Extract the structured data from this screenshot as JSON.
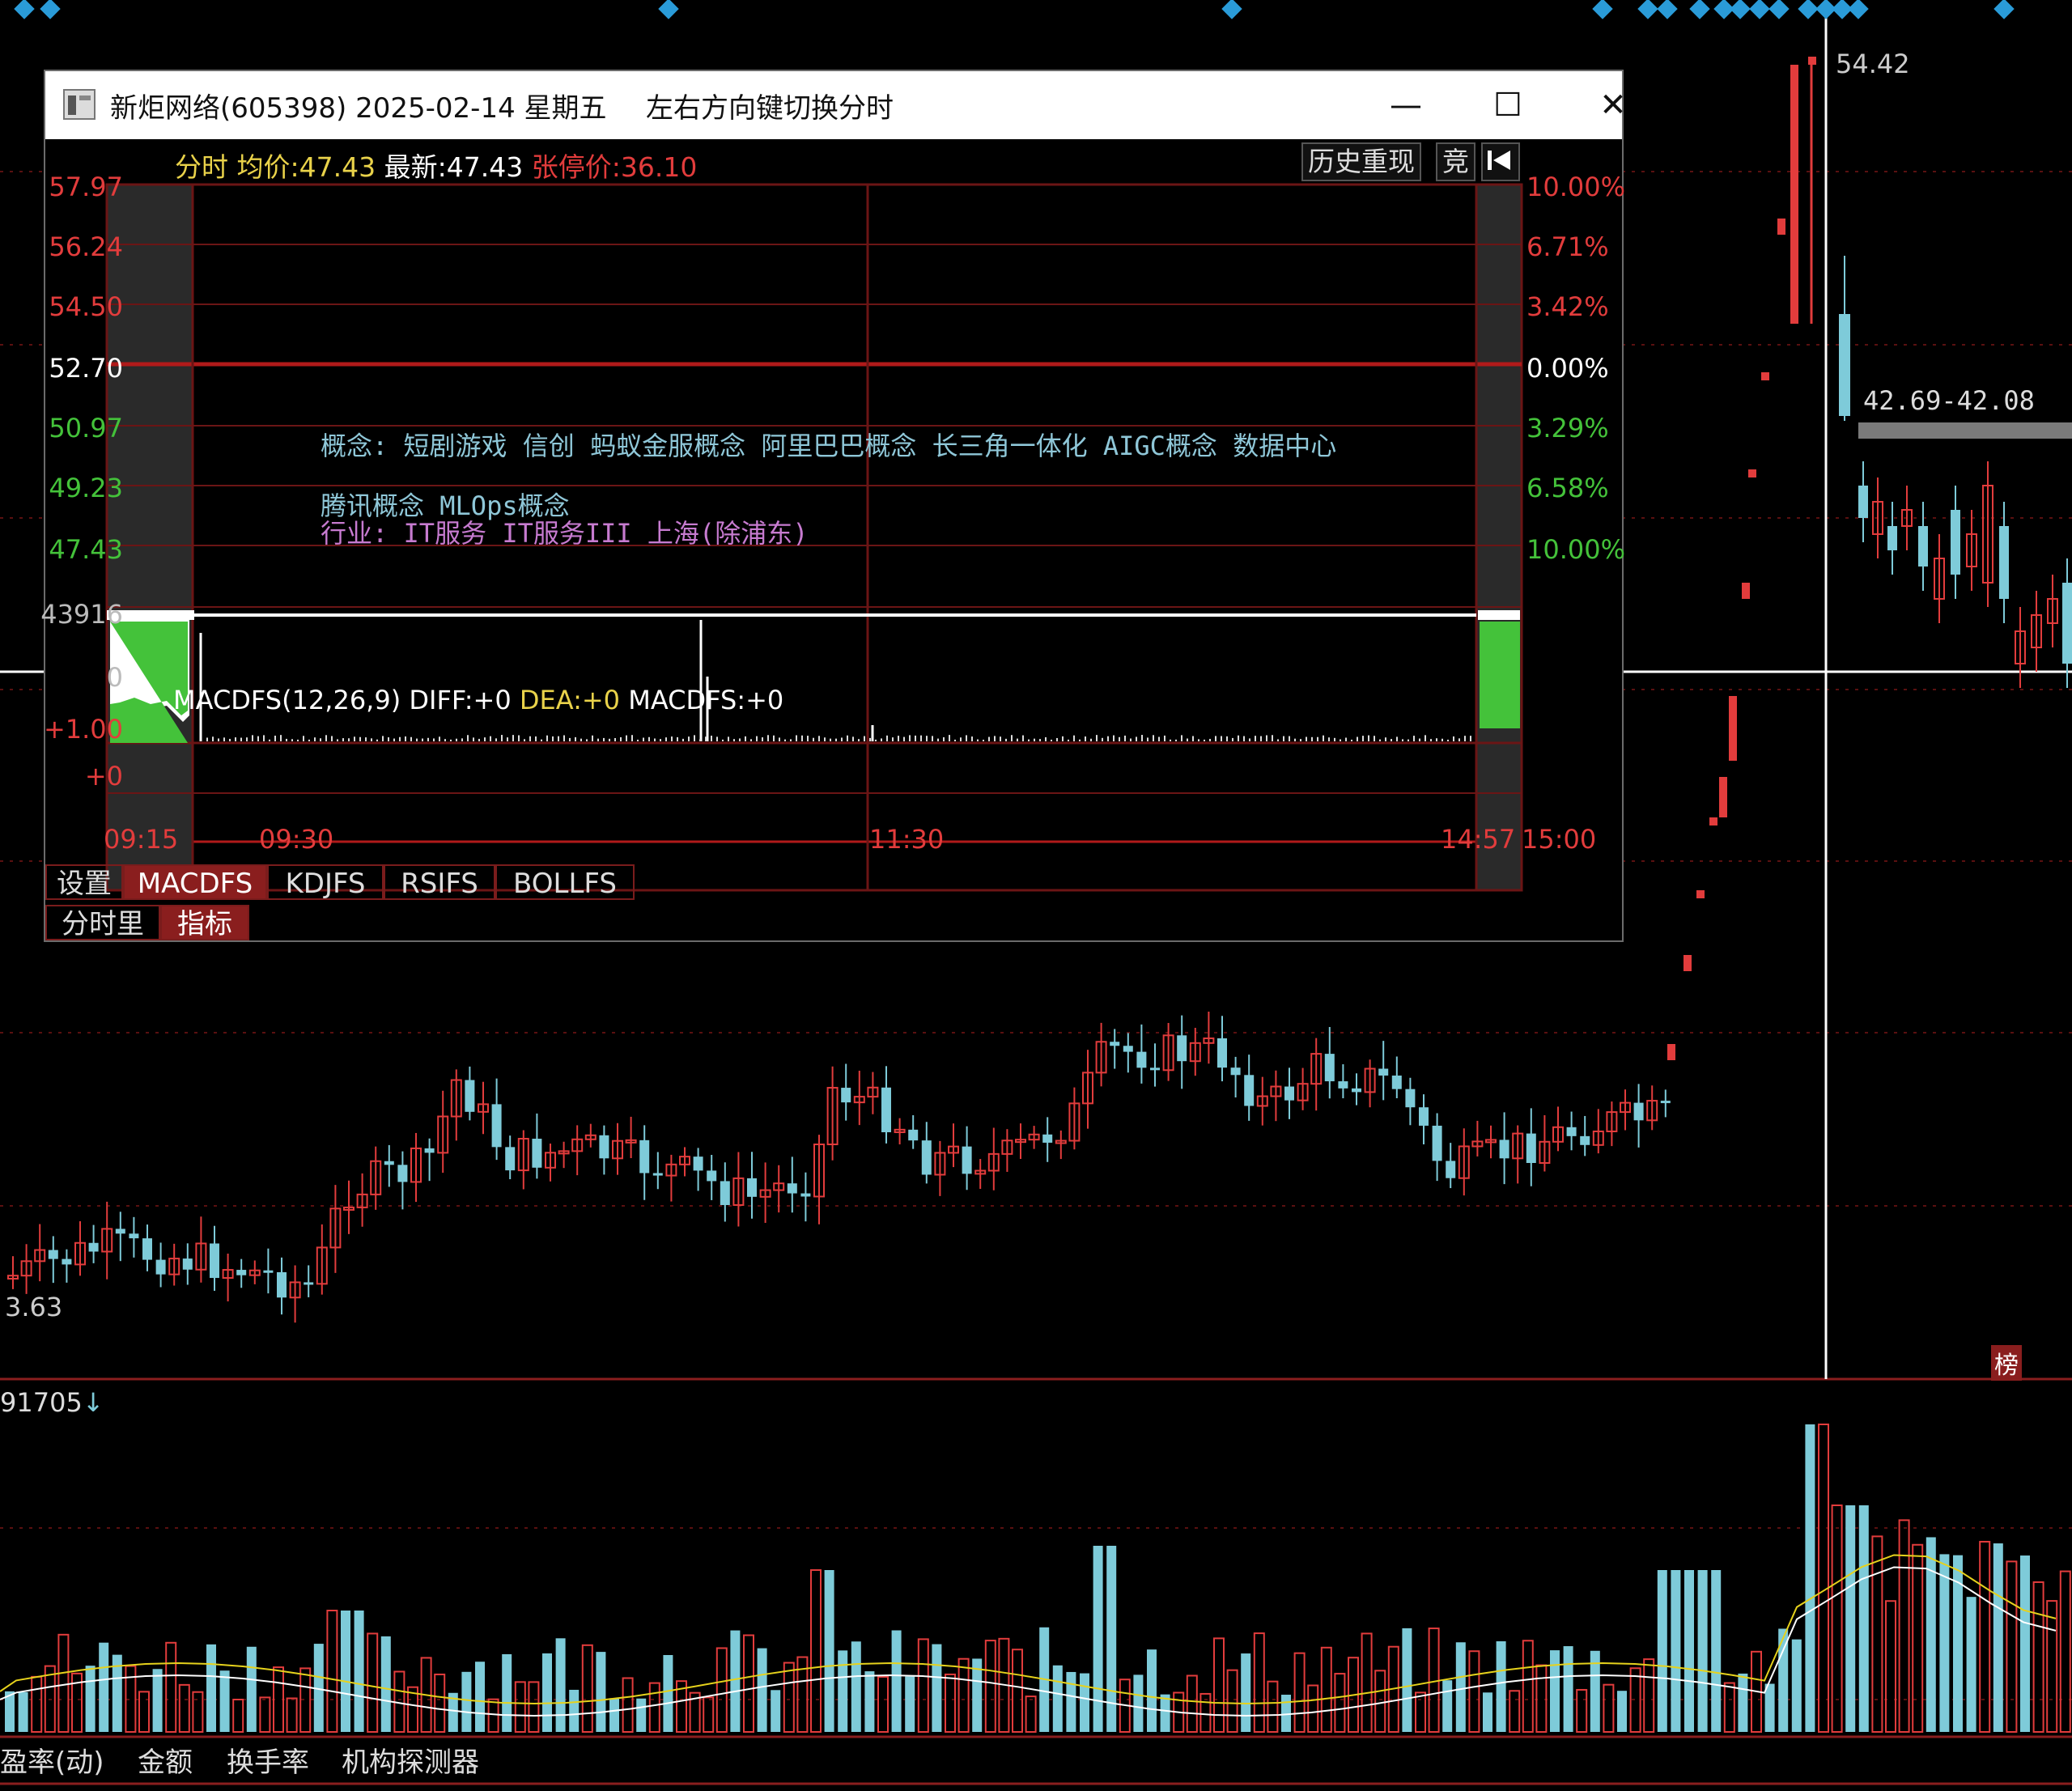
{
  "main_chart": {
    "price_right_label": "54.42",
    "range_label": "42.69-42.08",
    "low_label": "3.63",
    "list_badge": "榜",
    "volume_value": "91705"
  },
  "bottom_tabs": [
    "盈率(动)",
    "金额",
    "换手率",
    "机构探测器"
  ],
  "popup": {
    "title": "新炬网络(605398) 2025-02-14 星期五",
    "hint": "左右方向键切换分时",
    "minimize": "—",
    "maximize": "☐",
    "close": "✕",
    "info": {
      "prefix": "分时",
      "avg_label": "均价:",
      "avg": "47.43",
      "last_label": "最新:",
      "last": "47.43",
      "limit_label": "张停价:",
      "limit": "36.10"
    },
    "history_btn": "历史重现",
    "auction_btn": "竞",
    "back_icon": "back-to-start-icon",
    "price_axis_left": [
      "57.97",
      "56.24",
      "54.50",
      "52.70",
      "50.97",
      "49.23",
      "47.43"
    ],
    "pct_axis_right": [
      "10.00%",
      "6.71%",
      "3.42%",
      "0.00%",
      "3.29%",
      "6.58%",
      "10.00%"
    ],
    "volume_axis": [
      "43916",
      "0"
    ],
    "concept_line1": "概念: 短剧游戏 信创 蚂蚁金服概念 阿里巴巴概念 长三角一体化 AIGC概念 数据中心",
    "concept_line2": "腾讯概念 MLOps概念",
    "industry_line": "行业: IT服务  IT服务III  上海(除浦东)",
    "macd": {
      "name": "MACDFS(12,26,9)",
      "diff_label": "DIFF:",
      "diff": "+0",
      "dea_label": "DEA:",
      "dea": "+0",
      "macd_label": "MACDFS:",
      "macd": "+0",
      "axis": [
        "+1.00",
        "+0"
      ]
    },
    "time_axis": [
      "09:15",
      "09:30",
      "11:30",
      "14:57",
      "15:00"
    ],
    "indicator_tabs": [
      "设置",
      "MACDFS",
      "KDJFS",
      "RSIFS",
      "BOLLFS"
    ],
    "mode_tabs": [
      "分时里",
      "指标"
    ],
    "colors": {
      "up": "#e23c3c",
      "down": "#7ecbd9",
      "green": "#44c23a",
      "grid": "#6b1515"
    }
  }
}
